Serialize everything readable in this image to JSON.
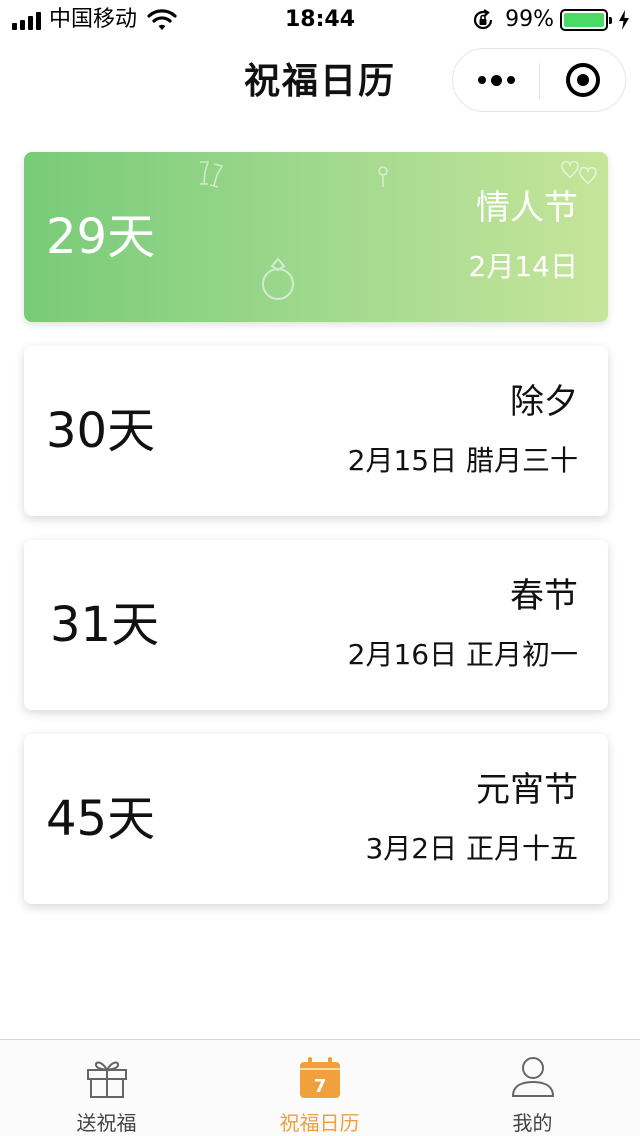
{
  "status_bar": {
    "carrier": "中国移动",
    "time": "18:44",
    "battery_percent": "99%",
    "battery_level": 0.99,
    "battery_color": "#4cd964"
  },
  "nav": {
    "title": "祝福日历",
    "more_icon": "more-dots-icon",
    "close_icon": "target-circle-icon"
  },
  "holidays": [
    {
      "days": "29天",
      "name": "情人节",
      "date": "2月14日",
      "featured": true
    },
    {
      "days": "30天",
      "name": "除夕",
      "date": "2月15日 腊月三十",
      "featured": false
    },
    {
      "days": "31天",
      "name": "春节",
      "date": "2月16日 正月初一",
      "featured": false
    },
    {
      "days": "45天",
      "name": "元宵节",
      "date": "3月2日 正月十五",
      "featured": false
    }
  ],
  "featured_gradient": [
    "#78cb78",
    "#c6e59a"
  ],
  "tabbar": {
    "active_color": "#f0a03c",
    "items": [
      {
        "label": "送祝福",
        "icon": "gift-icon"
      },
      {
        "label": "祝福日历",
        "icon": "calendar-icon",
        "icon_text": "7",
        "active": true
      },
      {
        "label": "我的",
        "icon": "user-icon"
      }
    ]
  }
}
